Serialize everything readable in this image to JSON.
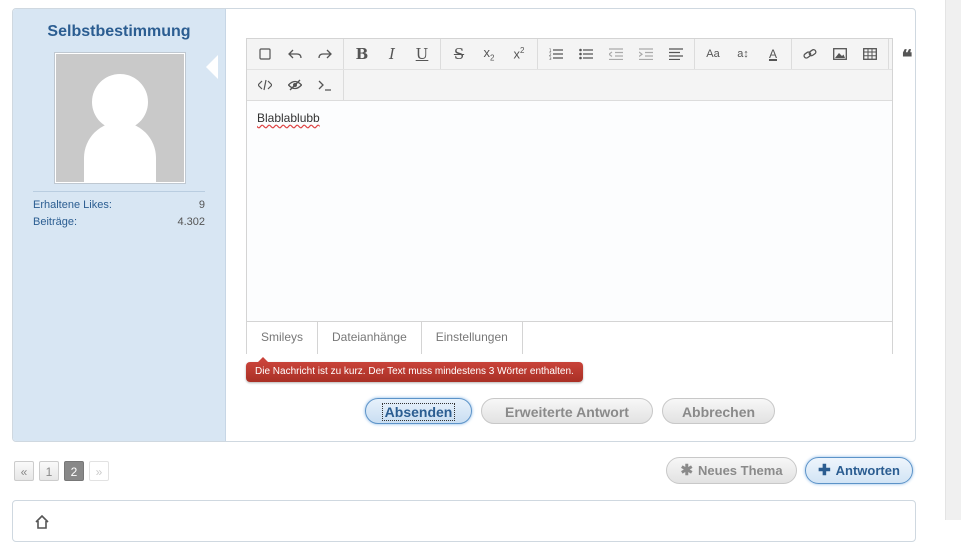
{
  "author": {
    "name": "Selbstbestimmung",
    "stats": [
      {
        "label": "Erhaltene Likes:",
        "value": "9"
      },
      {
        "label": "Beiträge:",
        "value": "4.302"
      }
    ]
  },
  "editor": {
    "toolbar_row1": [
      [
        "source-toggle-icon",
        "undo-icon",
        "redo-icon"
      ],
      [
        "bold-icon",
        "italic-icon",
        "underline-icon"
      ],
      [
        "strikethrough-icon",
        "subscript-icon",
        "superscript-icon"
      ],
      [
        "ordered-list-icon",
        "unordered-list-icon",
        "outdent-icon",
        "indent-icon",
        "align-icon"
      ],
      [
        "font-size-icon",
        "text-transform-icon",
        "font-color-icon"
      ],
      [
        "link-icon",
        "image-icon",
        "table-icon"
      ],
      [
        "quote-icon"
      ]
    ],
    "toolbar_row2": [
      "code-icon",
      "spoiler-icon",
      "inline-code-icon"
    ],
    "content": "Blablablubb",
    "tabs": [
      "Smileys",
      "Dateianhänge",
      "Einstellungen"
    ]
  },
  "error_message": "Die Nachricht ist zu kurz. Der Text muss mindestens 3 Wörter enthalten.",
  "form_buttons": {
    "submit": "Absenden",
    "extended": "Erweiterte Antwort",
    "cancel": "Abbrechen"
  },
  "pagination": {
    "prev": "«",
    "pages": [
      "1",
      "2"
    ],
    "current": "2",
    "next": "»"
  },
  "actions": {
    "new_thread": "Neues Thema",
    "reply": "Antworten"
  },
  "colors": {
    "sidebar": "#d8e6f3",
    "accent": "#2b5d91",
    "error": "#c0392b"
  }
}
